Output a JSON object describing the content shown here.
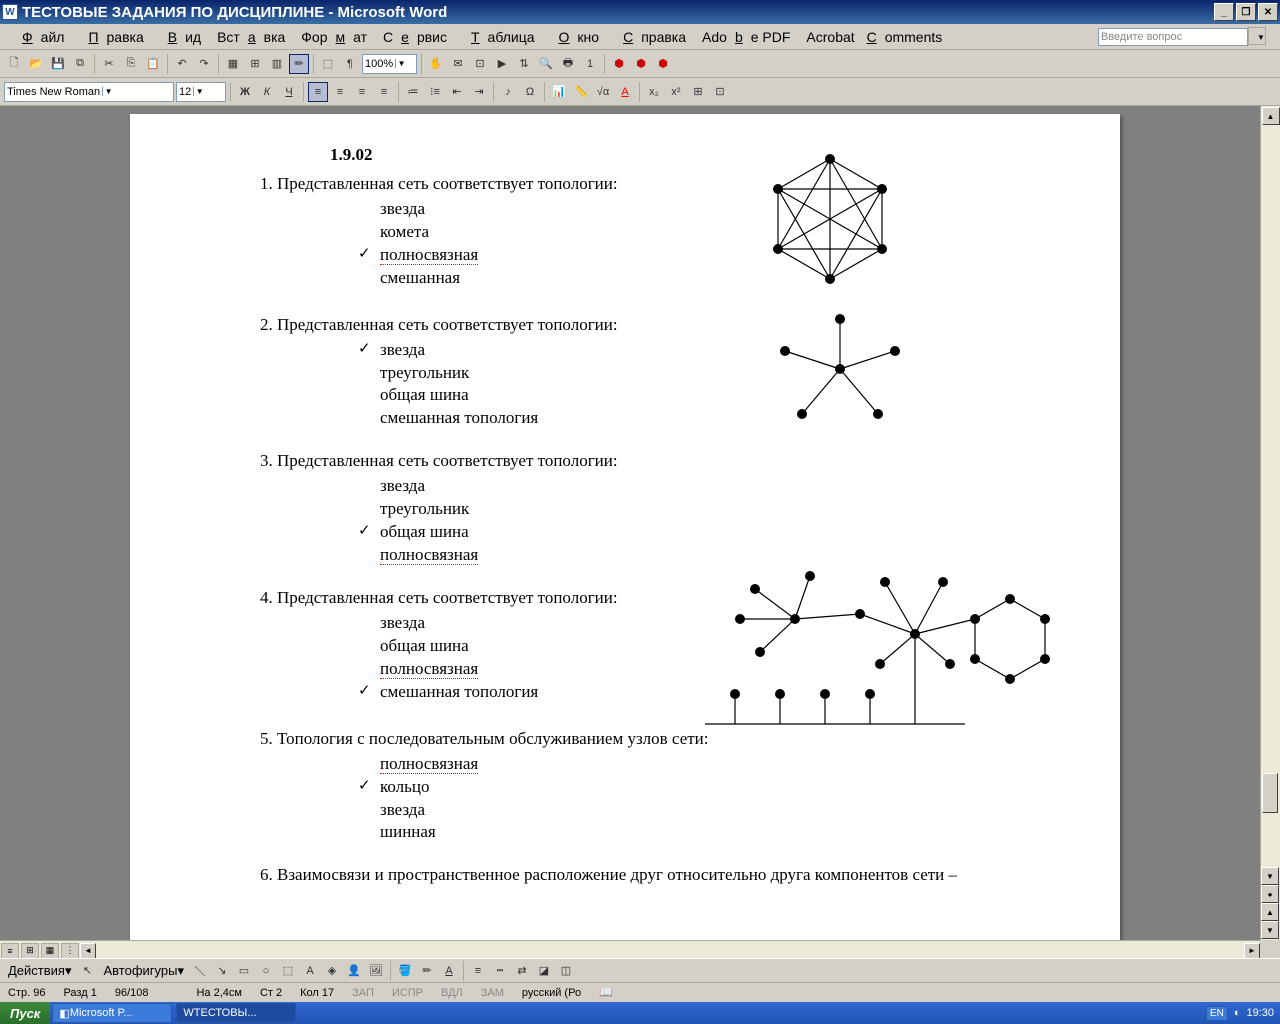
{
  "title": "ТЕСТОВЫЕ ЗАДАНИЯ ПО ДИСЦИПЛИНЕ - Microsoft Word",
  "menu": [
    "Файл",
    "Правка",
    "Вид",
    "Вставка",
    "Формат",
    "Сервис",
    "Таблица",
    "Окно",
    "Справка",
    "Adobe PDF",
    "Acrobat Comments"
  ],
  "question_placeholder": "Введите вопрос",
  "font_name": "Times New Roman",
  "font_size": "12",
  "zoom": "100%",
  "dejstvia": "Действия",
  "autoshapes": "Автофигуры",
  "section": "1.9.02",
  "questions": [
    {
      "n": "1.",
      "text": "Представленная сеть соответствует топологии:",
      "opts": [
        {
          "t": "звезда",
          "c": false
        },
        {
          "t": "комета",
          "c": false
        },
        {
          "t": "полносвязная",
          "c": true,
          "u": true
        },
        {
          "t": "смешанная",
          "c": false
        }
      ]
    },
    {
      "n": "2.",
      "text": "Представленная сеть соответствует топологии:",
      "opts": [
        {
          "t": "звезда",
          "c": true
        },
        {
          "t": "треугольник",
          "c": false
        },
        {
          "t": "общая шина",
          "c": false
        },
        {
          "t": "смешанная топология",
          "c": false
        }
      ]
    },
    {
      "n": "3.",
      "text": "Представленная сеть соответствует топологии:",
      "opts": [
        {
          "t": "звезда",
          "c": false
        },
        {
          "t": "треугольник",
          "c": false
        },
        {
          "t": "общая шина",
          "c": true
        },
        {
          "t": "полносвязная",
          "c": false,
          "u": true
        }
      ]
    },
    {
      "n": "4.",
      "text": "Представленная сеть соответствует топологии:",
      "opts": [
        {
          "t": "звезда",
          "c": false
        },
        {
          "t": "общая шина",
          "c": false
        },
        {
          "t": "полносвязная",
          "c": false,
          "u": true
        },
        {
          "t": "смешанная топология",
          "c": true
        }
      ]
    },
    {
      "n": "5.",
      "text": "Топология с последовательным обслуживанием узлов сети:",
      "opts": [
        {
          "t": "полносвязная",
          "c": false,
          "u": true
        },
        {
          "t": "кольцо",
          "c": true
        },
        {
          "t": "звезда",
          "c": false
        },
        {
          "t": "шинная",
          "c": false
        }
      ]
    },
    {
      "n": "6.",
      "text": "Взаимосвязи и пространственное расположение друг относительно друга компонентов сети –",
      "opts": []
    }
  ],
  "status": {
    "page": "Стр. 96",
    "section": "Разд 1",
    "pages": "96/108",
    "at": "На 2,4см",
    "line": "Ст 2",
    "col": "Кол 17",
    "rec": "ЗАП",
    "trk": "ИСПР",
    "ext": "ВДЛ",
    "ovr": "ЗАМ",
    "lang": "русский (Ро"
  },
  "taskbar": {
    "start": "Пуск",
    "task1": "Microsoft P...",
    "task2": "ТЕСТОВЫ...",
    "lang": "EN",
    "time": "19:30"
  }
}
